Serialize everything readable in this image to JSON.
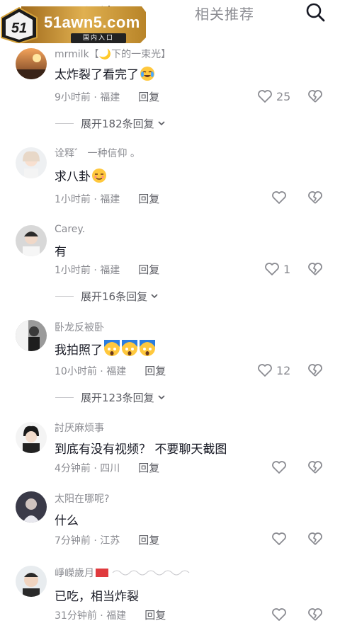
{
  "header": {
    "tab_comments": "评论127",
    "tab_related": "相关推荐",
    "search_icon": "search-icon"
  },
  "watermark": {
    "site": "51awn5.com",
    "subtitle": "国内入口",
    "badge": "51"
  },
  "comments": [
    {
      "username": "mrmilk【🌙下的一束光】",
      "text": "太炸裂了看完了",
      "time": "9小时前",
      "location": "福建",
      "reply": "回复",
      "likes": "25",
      "expand": "展开182条回复"
    },
    {
      "username": "诠释゛ 一种信仰 。",
      "text": "求八卦",
      "time": "1小时前",
      "location": "福建",
      "reply": "回复",
      "likes": ""
    },
    {
      "username": "Carey.",
      "text": "有",
      "time": "1小时前",
      "location": "福建",
      "reply": "回复",
      "likes": "1",
      "expand": "展开16条回复"
    },
    {
      "username": "卧龙反被卧",
      "text": "我拍照了",
      "time": "10小时前",
      "location": "福建",
      "reply": "回复",
      "likes": "12",
      "expand": "展开123条回复"
    },
    {
      "username": "討厌麻烦事",
      "text": "到底有没有视频？ 不要聊天截图",
      "time": "4分钟前",
      "location": "四川",
      "reply": "回复",
      "likes": ""
    },
    {
      "username": "太阳在哪呢?",
      "text": "什么",
      "time": "7分钟前",
      "location": "江苏",
      "reply": "回复",
      "likes": ""
    },
    {
      "username": "崢嶸歲月",
      "text": "已吃，相当炸裂",
      "time": "31分钟前",
      "location": "福建",
      "reply": "回复",
      "likes": ""
    }
  ],
  "colors": {
    "text": "#161823",
    "secondary": "#8a8b91",
    "background": "#ffffff",
    "logo_gold": "#d4a23c"
  }
}
